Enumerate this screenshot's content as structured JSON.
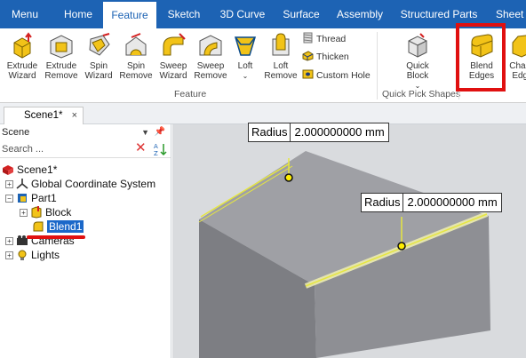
{
  "menu": {
    "tabs": [
      "Menu",
      "Home",
      "Feature",
      "Sketch",
      "3D Curve",
      "Surface",
      "Assembly",
      "Structured Parts",
      "Sheet M"
    ],
    "active": "Feature"
  },
  "ribbon": {
    "feature_buttons": [
      {
        "label": "Extrude\nWizard",
        "icon": "extrude-wizard-icon"
      },
      {
        "label": "Extrude\nRemove",
        "icon": "extrude-remove-icon"
      },
      {
        "label": "Spin\nWizard",
        "icon": "spin-wizard-icon"
      },
      {
        "label": "Spin\nRemove",
        "icon": "spin-remove-icon"
      },
      {
        "label": "Sweep\nWizard",
        "icon": "sweep-wizard-icon"
      },
      {
        "label": "Sweep\nRemove",
        "icon": "sweep-remove-icon"
      },
      {
        "label": "Loft\n",
        "icon": "loft-icon"
      },
      {
        "label": "Loft\nRemove",
        "icon": "loft-remove-icon"
      }
    ],
    "small_buttons": [
      "Thread",
      "Thicken",
      "Custom Hole"
    ],
    "feature_group_label": "Feature",
    "quick_block": {
      "label": "Quick\nBlock"
    },
    "quick_pick_label": "Quick Pick Shapes",
    "blend_edges": {
      "label": "Blend\nEdges"
    },
    "chamfer_edges": {
      "label": "Chamf\nEdge"
    }
  },
  "document": {
    "tab_title": "Scene1*",
    "close": "×"
  },
  "scene_panel": {
    "title": "Scene",
    "search_placeholder": "Search ...",
    "tree": [
      {
        "label": "Scene1*",
        "icon": "scene-icon"
      },
      {
        "label": "Global Coordinate System",
        "icon": "axes-icon"
      },
      {
        "label": "Part1",
        "icon": "part-icon"
      },
      {
        "label": "Block",
        "icon": "block-icon"
      },
      {
        "label": "Blend1",
        "icon": "blend-icon",
        "selected": true
      },
      {
        "label": "Cameras",
        "icon": "camera-icon"
      },
      {
        "label": "Lights",
        "icon": "light-icon"
      }
    ]
  },
  "viewport": {
    "radius_labels": [
      {
        "key": "Radius",
        "value": "2.000000000 mm"
      },
      {
        "key": "Radius",
        "value": "2.000000000 mm"
      }
    ]
  }
}
